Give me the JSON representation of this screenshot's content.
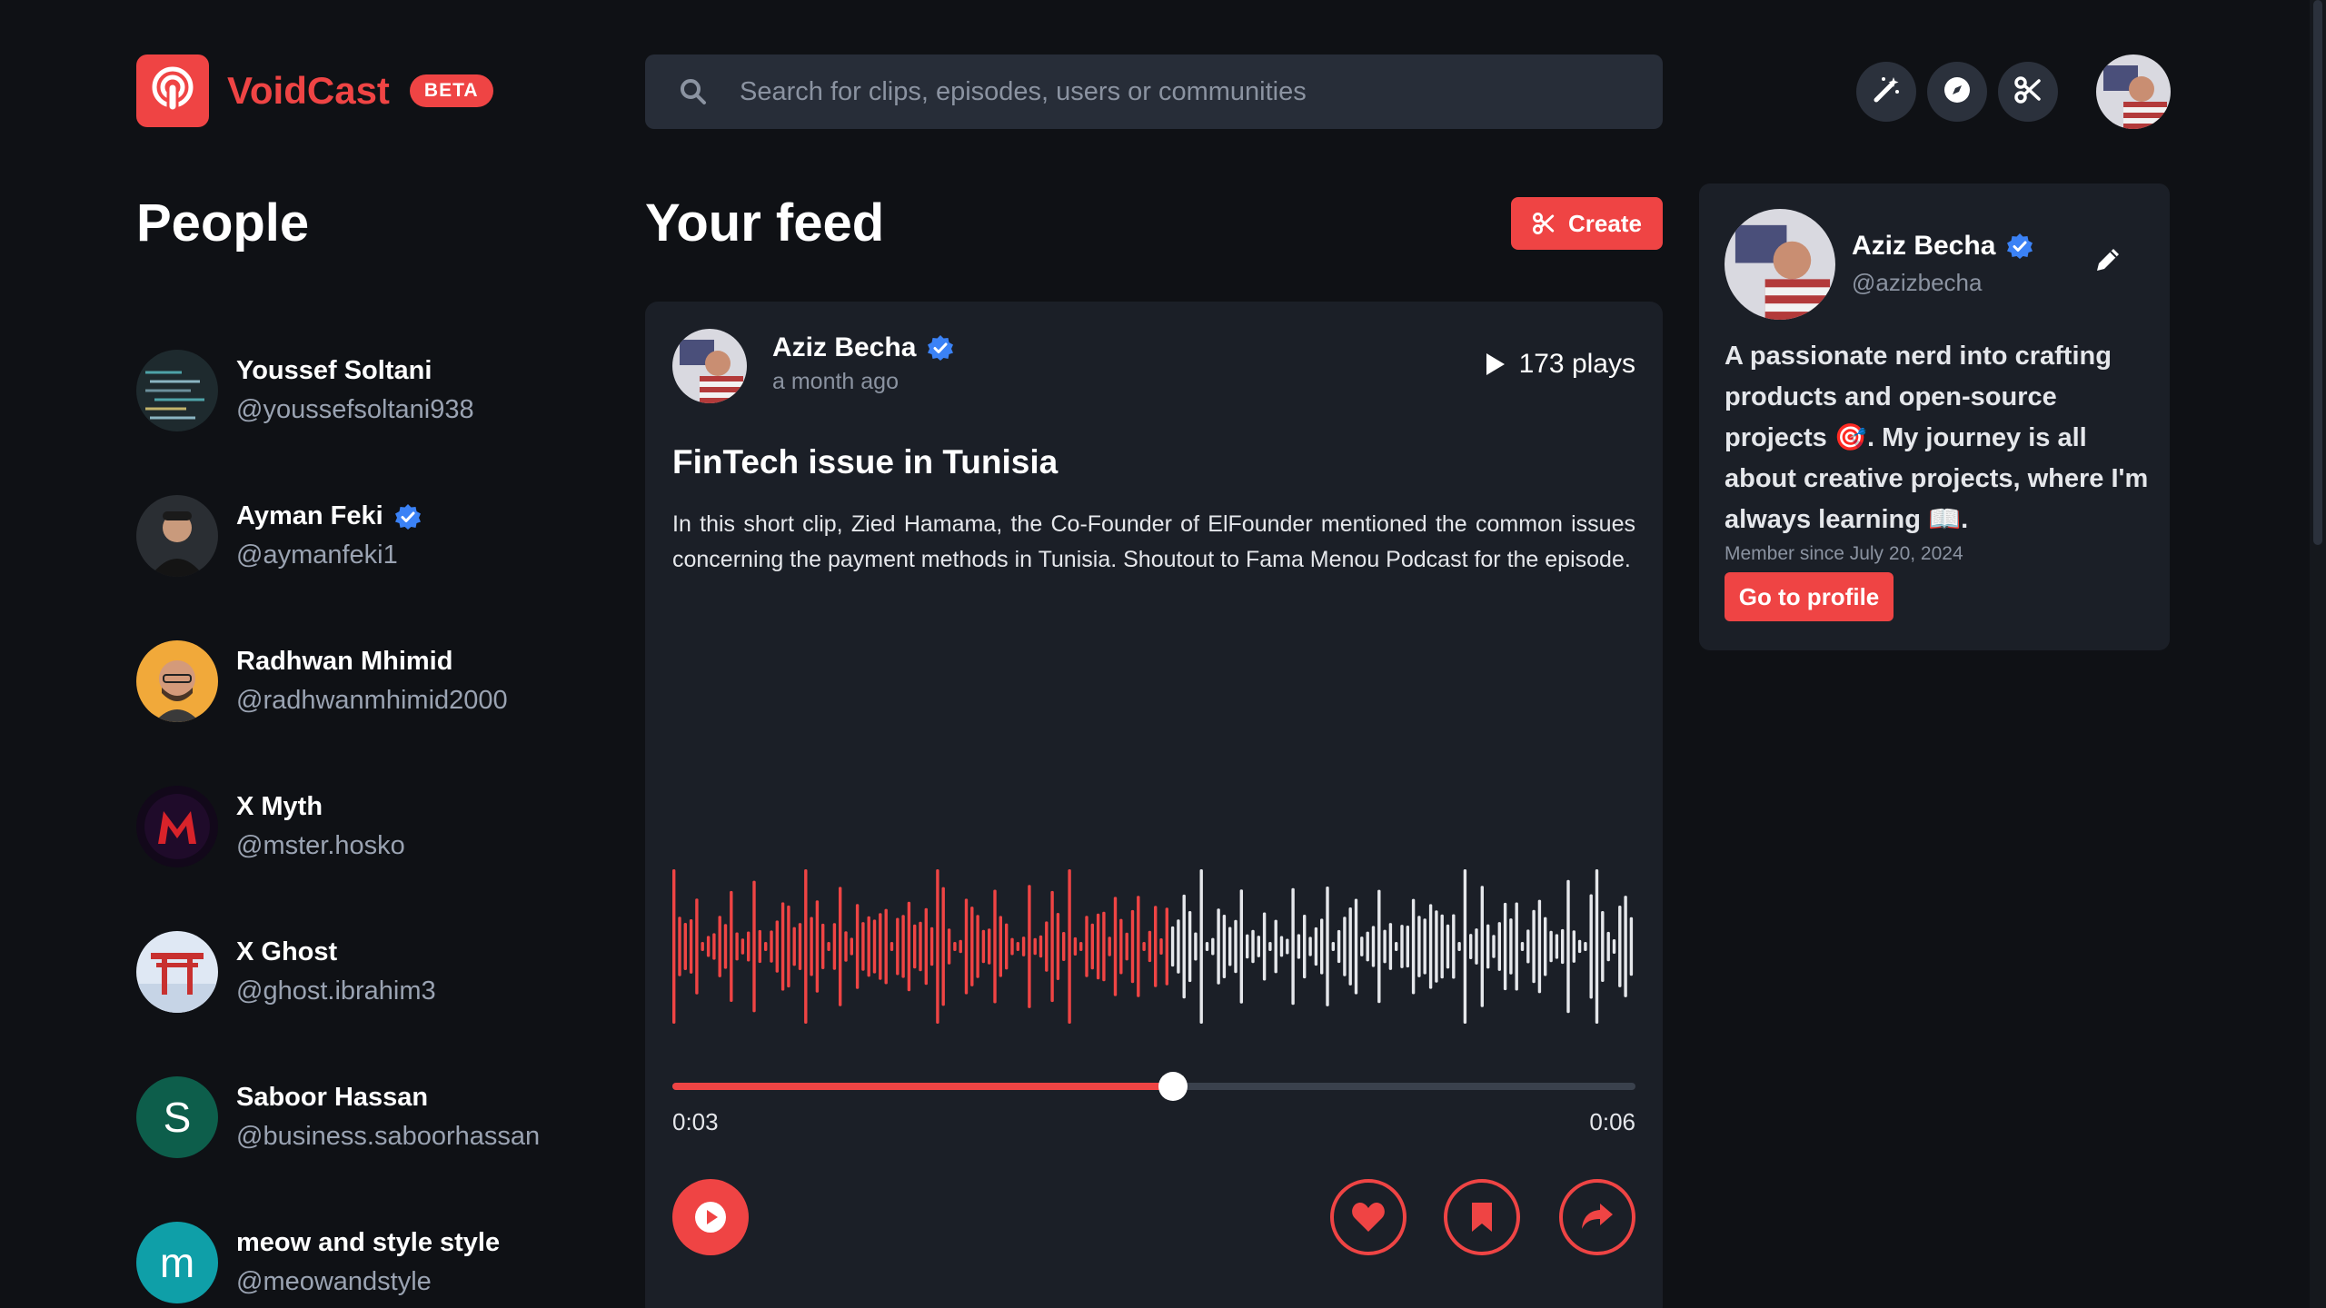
{
  "app": {
    "name": "VoidCast",
    "badge": "BETA",
    "accent": "#ef4444"
  },
  "search": {
    "placeholder": "Search for clips, episodes, users or communities"
  },
  "header_icons": [
    "magic-wand-icon",
    "compass-icon",
    "scissors-icon"
  ],
  "people": {
    "title": "People",
    "items": [
      {
        "name": "Youssef Soltani",
        "handle": "@youssefsoltani938",
        "verified": false,
        "avatar": "code-photo"
      },
      {
        "name": "Ayman Feki",
        "handle": "@aymanfeki1",
        "verified": true,
        "avatar": "portrait"
      },
      {
        "name": "Radhwan Mhimid",
        "handle": "@radhwanmhimid2000",
        "verified": false,
        "avatar": "portrait-yellow"
      },
      {
        "name": "X Myth",
        "handle": "@mster.hosko",
        "verified": false,
        "avatar": "red-m-logo"
      },
      {
        "name": "X Ghost",
        "handle": "@ghost.ibrahim3",
        "verified": false,
        "avatar": "torii-gate"
      },
      {
        "name": "Saboor Hassan",
        "handle": "@business.saboorhassan",
        "verified": false,
        "avatar": "S",
        "avatar_color": "#0d5e4b"
      },
      {
        "name": "meow and style style",
        "handle": "@meowandstyle",
        "verified": false,
        "avatar": "m",
        "avatar_color": "#0f9fa8"
      }
    ]
  },
  "feed": {
    "title": "Your feed",
    "create_label": "Create",
    "post": {
      "author": "Aziz Becha",
      "verified": true,
      "time": "a month ago",
      "plays": "173 plays",
      "title": "FinTech issue in Tunisia",
      "description": "In this short clip, Zied Hamama, the Co-Founder of ElFounder mentioned the common issues concerning the payment methods in Tunisia. Shoutout to Fama Menou Podcast for the episode.",
      "current_time": "0:03",
      "total_time": "0:06",
      "progress": 0.52
    }
  },
  "profile": {
    "name": "Aziz Becha",
    "handle": "@azizbecha",
    "verified": true,
    "bio": "A passionate nerd into crafting products and open-source projects 🎯. My journey is all about creative projects, where I'm always learning 📖.",
    "member_since": "Member since July 20, 2024",
    "button": "Go to profile"
  }
}
